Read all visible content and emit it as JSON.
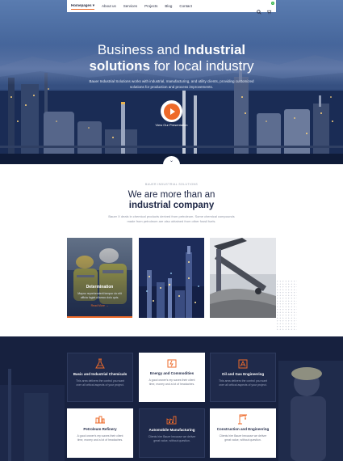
{
  "nav": {
    "items": [
      "Homepages ▾",
      "About us",
      "Services",
      "Projects",
      "Blog",
      "Contact"
    ],
    "cart_count": "0"
  },
  "hero": {
    "title_light_1": "Business and ",
    "title_bold_1": "Industrial",
    "title_bold_2": "solutions",
    "title_light_2": " for local industry",
    "subtitle": "Bauer Industrial Solutions works with industrial, manufacturing, and utility clients, providing customized solutions for production and process improvements.",
    "play_label": "View Our Presentation"
  },
  "about": {
    "eyebrow": "BAUER INDUSTRIAL SOLUTIONS",
    "title_light": "We are more than an",
    "title_bold": "industrial company",
    "text": "Bauer X deals in chemical products derived from petroleum. Some chemical compounds made from petroleum are also obtained from other fossil fuels."
  },
  "cards": [
    {
      "title": "Determination",
      "text": "Mayno reprehenderit tempor do elit officia fugiat ullamco dolo quis.",
      "link": "Read More →"
    },
    {},
    {}
  ],
  "services": [
    {
      "title": "Basic and Industrial Chemicals",
      "text": "This area delivers the control you want over all critical aspects of your project."
    },
    {
      "title": "Energy and Commodities",
      "text": "A good owner's rep saves their client time, money and a lot of headaches."
    },
    {
      "title": "Oil and Gas Engineering",
      "text": "This area delivers the control you want over all critical aspects of your project."
    },
    {
      "title": "Petroleum Refinery",
      "text": "A good owner's rep saves their client time, money and a lot of headaches."
    },
    {
      "title": "Automobile Manufacturing",
      "text": "Clients hire Bauer because we deliver great value, without question."
    },
    {
      "title": "Construction and Engineering",
      "text": "Clients hire Bauer because we deliver great value, without question."
    }
  ],
  "colors": {
    "accent": "#ee6a2a",
    "navy": "#1c2544",
    "services_bg": "#1b2646"
  },
  "icons": [
    "search-icon",
    "cart-icon",
    "play-icon",
    "chevron-down-icon",
    "flask-icon",
    "energy-icon",
    "oil-rig-icon",
    "refinery-icon",
    "factory-icon",
    "crane-icon"
  ]
}
